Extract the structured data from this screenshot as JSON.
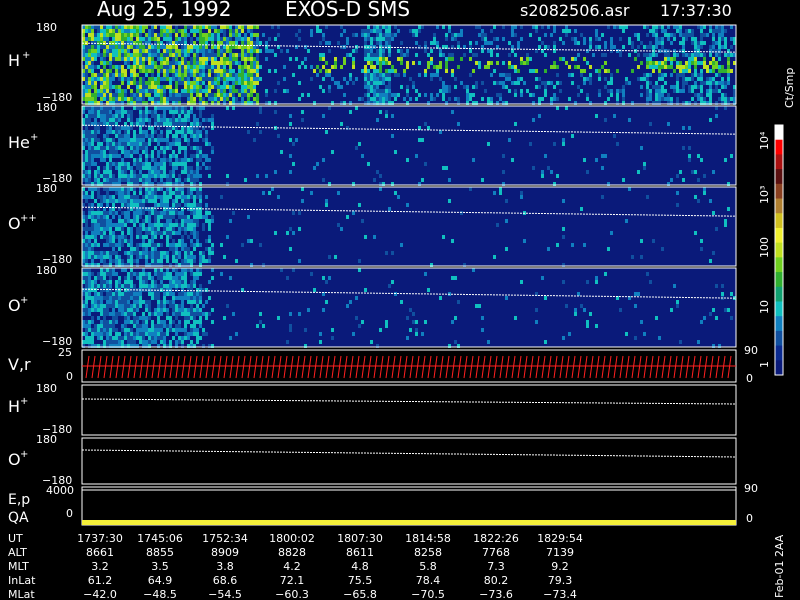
{
  "header": {
    "date": "Aug 25, 1992",
    "instrument": "EXOS-D SMS",
    "file": "s2082506.asr",
    "time": "17:37:30"
  },
  "colors": {
    "background": "#000000",
    "spectrogram_bg": "#0a1a7a",
    "trace": "#ffffff",
    "vr_bars": "#ff2020",
    "qa_bar": "#f5f03a"
  },
  "panels": [
    {
      "label": "H",
      "sup": "+",
      "ymax": "180",
      "ymin": "−180",
      "kind": "spectrogram",
      "activity": "high"
    },
    {
      "label": "He",
      "sup": "+",
      "ymax": "180",
      "ymin": "−180",
      "kind": "spectrogram",
      "activity": "low"
    },
    {
      "label": "O",
      "sup": "++",
      "ymax": "180",
      "ymin": "−180",
      "kind": "spectrogram",
      "activity": "low"
    },
    {
      "label": "O",
      "sup": "+",
      "ymax": "180",
      "ymin": "−180",
      "kind": "spectrogram",
      "activity": "low"
    }
  ],
  "vr_panel": {
    "label": "V,r",
    "ymax": "25",
    "ymin": "0",
    "right_max": "90",
    "right_min": "0"
  },
  "line_panels": [
    {
      "label": "H",
      "sup": "+",
      "ymax": "180",
      "ymin": "−180"
    },
    {
      "label": "O",
      "sup": "+",
      "ymax": "180",
      "ymin": "−180"
    }
  ],
  "ep_panel": {
    "label1": "E,p",
    "label2": "QA",
    "ymax": "4000",
    "ymin": "0",
    "right_max": "90",
    "right_min": "0"
  },
  "colorbar": {
    "unit": "Ct/Smp",
    "ticks": [
      "10⁴",
      "10³",
      "100",
      "10",
      "1"
    ],
    "colors": [
      "#ffffff",
      "#ff0000",
      "#aa1010",
      "#5a1010",
      "#8a4020",
      "#b08030",
      "#d0c020",
      "#f0f030",
      "#c0e020",
      "#70d020",
      "#30b030",
      "#10a070",
      "#10c0c0",
      "#1080c0",
      "#1050a0",
      "#0a2a90",
      "#0a1a7a"
    ]
  },
  "chart_data": {
    "type": "heatmap",
    "title": "Aug 25, 1992   EXOS-D SMS",
    "x_ticks": [
      "1737:30",
      "1745:06",
      "1752:34",
      "1800:02",
      "1807:30",
      "1814:58",
      "1822:26",
      "1829:54"
    ],
    "ephemeris": {
      "UT": [
        "1737:30",
        "1745:06",
        "1752:34",
        "1800:02",
        "1807:30",
        "1814:58",
        "1822:26",
        "1829:54"
      ],
      "ALT": [
        "8661",
        "8855",
        "8909",
        "8828",
        "8611",
        "8258",
        "7768",
        "7139"
      ],
      "MLT": [
        "3.2",
        "3.5",
        "3.8",
        "4.2",
        "4.8",
        "5.8",
        "7.3",
        "9.2"
      ],
      "InLat": [
        "61.2",
        "64.9",
        "68.6",
        "72.1",
        "75.5",
        "78.4",
        "80.2",
        "79.3"
      ],
      "MLat": [
        "−42.0",
        "−48.5",
        "−54.5",
        "−60.3",
        "−65.8",
        "−70.5",
        "−73.6",
        "−73.4"
      ]
    },
    "ylim_angle": [
      -180,
      180
    ],
    "ylim_vr": [
      0,
      25
    ],
    "ylim_ep": [
      0,
      4000
    ],
    "colorscale": "log",
    "colorbar_range": [
      1,
      10000
    ]
  },
  "footer_note": "Feb-01 2AA"
}
